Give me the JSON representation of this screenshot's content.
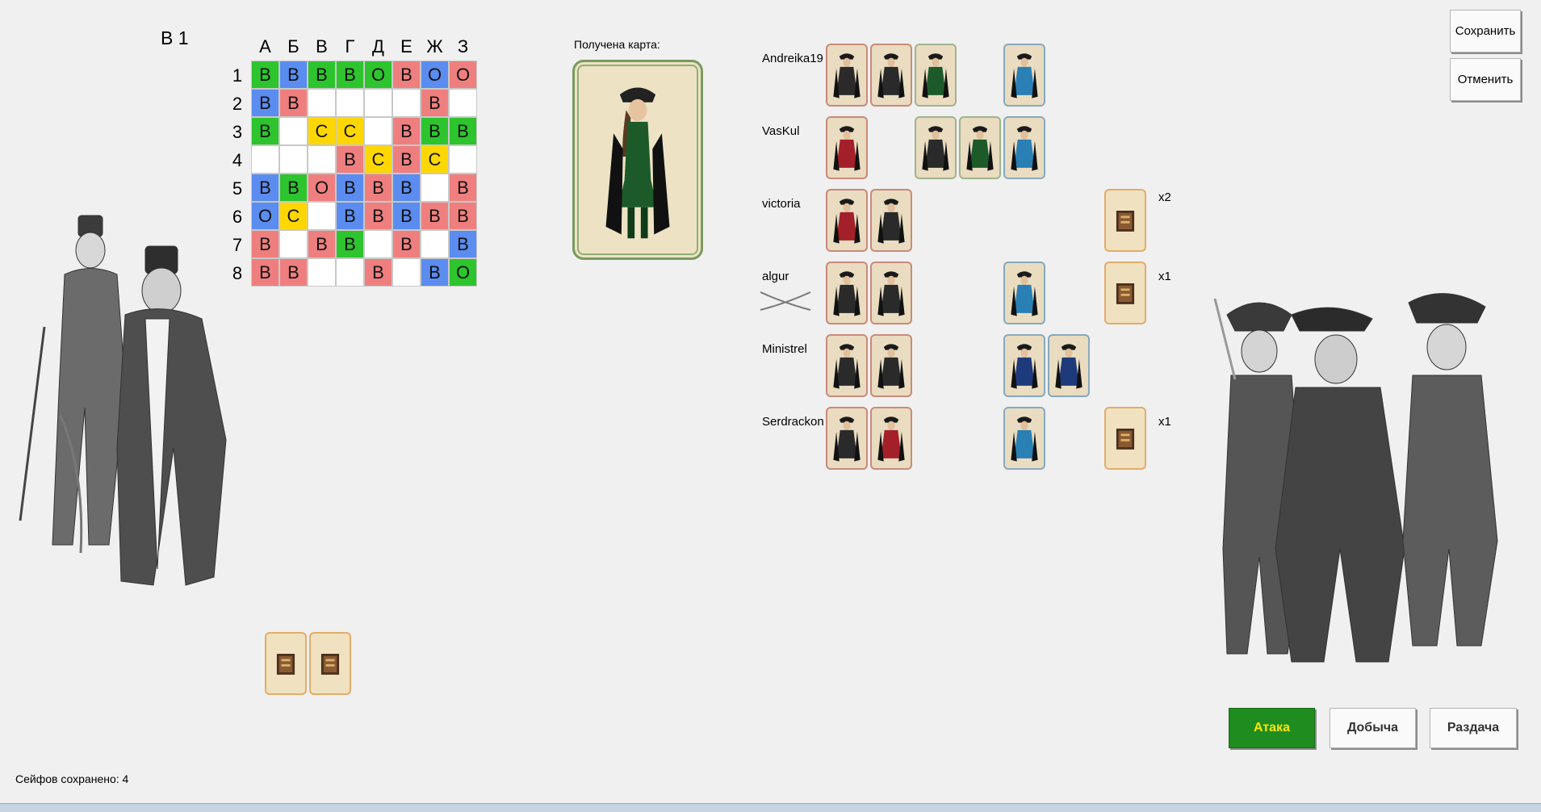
{
  "round": "В 1",
  "board": {
    "columns": [
      "А",
      "Б",
      "В",
      "Г",
      "Д",
      "Е",
      "Ж",
      "З"
    ],
    "rows": [
      "1",
      "2",
      "3",
      "4",
      "5",
      "6",
      "7",
      "8"
    ],
    "cells": [
      [
        {
          "t": "В",
          "c": "O"
        },
        {
          "t": "В",
          "c": "U"
        },
        {
          "t": "В",
          "c": "O"
        },
        {
          "t": "В",
          "c": "O"
        },
        {
          "t": "О",
          "c": "O"
        },
        {
          "t": "В",
          "c": "B"
        },
        {
          "t": "О",
          "c": "U"
        },
        {
          "t": "О",
          "c": "B"
        }
      ],
      [
        {
          "t": "В",
          "c": "U"
        },
        {
          "t": "В",
          "c": "B"
        },
        {
          "t": "",
          "c": ""
        },
        {
          "t": "",
          "c": ""
        },
        {
          "t": "",
          "c": ""
        },
        {
          "t": "",
          "c": ""
        },
        {
          "t": "В",
          "c": "B"
        },
        {
          "t": "",
          "c": ""
        }
      ],
      [
        {
          "t": "В",
          "c": "O"
        },
        {
          "t": "",
          "c": ""
        },
        {
          "t": "С",
          "c": "Y"
        },
        {
          "t": "С",
          "c": "Y"
        },
        {
          "t": "",
          "c": ""
        },
        {
          "t": "В",
          "c": "B"
        },
        {
          "t": "В",
          "c": "O"
        },
        {
          "t": "В",
          "c": "O"
        }
      ],
      [
        {
          "t": "",
          "c": ""
        },
        {
          "t": "",
          "c": ""
        },
        {
          "t": "",
          "c": ""
        },
        {
          "t": "В",
          "c": "B"
        },
        {
          "t": "С",
          "c": "Y"
        },
        {
          "t": "В",
          "c": "B"
        },
        {
          "t": "С",
          "c": "Y"
        },
        {
          "t": "",
          "c": ""
        }
      ],
      [
        {
          "t": "В",
          "c": "U"
        },
        {
          "t": "В",
          "c": "O"
        },
        {
          "t": "О",
          "c": "B"
        },
        {
          "t": "В",
          "c": "U"
        },
        {
          "t": "В",
          "c": "B"
        },
        {
          "t": "В",
          "c": "U"
        },
        {
          "t": "",
          "c": ""
        },
        {
          "t": "В",
          "c": "B"
        }
      ],
      [
        {
          "t": "О",
          "c": "U"
        },
        {
          "t": "С",
          "c": "Y"
        },
        {
          "t": "",
          "c": ""
        },
        {
          "t": "В",
          "c": "U"
        },
        {
          "t": "В",
          "c": "B"
        },
        {
          "t": "В",
          "c": "U"
        },
        {
          "t": "В",
          "c": "B"
        },
        {
          "t": "В",
          "c": "B"
        }
      ],
      [
        {
          "t": "В",
          "c": "B"
        },
        {
          "t": "",
          "c": ""
        },
        {
          "t": "В",
          "c": "B"
        },
        {
          "t": "В",
          "c": "O"
        },
        {
          "t": "",
          "c": ""
        },
        {
          "t": "В",
          "c": "B"
        },
        {
          "t": "",
          "c": ""
        },
        {
          "t": "В",
          "c": "U"
        }
      ],
      [
        {
          "t": "В",
          "c": "B"
        },
        {
          "t": "В",
          "c": "B"
        },
        {
          "t": "",
          "c": ""
        },
        {
          "t": "",
          "c": ""
        },
        {
          "t": "В",
          "c": "B"
        },
        {
          "t": "",
          "c": ""
        },
        {
          "t": "В",
          "c": "U"
        },
        {
          "t": "О",
          "c": "O"
        }
      ]
    ]
  },
  "received_card_label": "Получена карта:",
  "players": [
    {
      "name": "Andreika19",
      "cards": [
        {
          "slot": 0,
          "type": "pirate-dark",
          "border": "red"
        },
        {
          "slot": 1,
          "type": "pirate-dark",
          "border": "red"
        },
        {
          "slot": 2,
          "type": "pirate-green",
          "border": "green"
        },
        {
          "slot": 4,
          "type": "pirate-blue",
          "border": "blue"
        }
      ],
      "safe": false,
      "multiplier": ""
    },
    {
      "name": "VasKul",
      "cards": [
        {
          "slot": 0,
          "type": "pirate-red",
          "border": "red"
        },
        {
          "slot": 2,
          "type": "pirate-dark",
          "border": "green"
        },
        {
          "slot": 3,
          "type": "pirate-green",
          "border": "green"
        },
        {
          "slot": 4,
          "type": "pirate-blue",
          "border": "blue"
        }
      ],
      "safe": false,
      "multiplier": ""
    },
    {
      "name": "victoria",
      "cards": [
        {
          "slot": 0,
          "type": "pirate-red",
          "border": "red"
        },
        {
          "slot": 1,
          "type": "pirate-dark",
          "border": "red"
        }
      ],
      "safe": true,
      "multiplier": "x2"
    },
    {
      "name": "algur",
      "cards": [
        {
          "slot": 0,
          "type": "pirate-dark",
          "border": "red"
        },
        {
          "slot": 1,
          "type": "pirate-dark",
          "border": "red"
        },
        {
          "slot": 4,
          "type": "pirate-blue",
          "border": "blue"
        }
      ],
      "safe": true,
      "multiplier": "x1"
    },
    {
      "name": "Ministrel",
      "cards": [
        {
          "slot": 0,
          "type": "pirate-dark",
          "border": "red"
        },
        {
          "slot": 1,
          "type": "pirate-dark",
          "border": "red"
        },
        {
          "slot": 4,
          "type": "pirate-navy",
          "border": "blue"
        },
        {
          "slot": 5,
          "type": "pirate-navy",
          "border": "blue"
        }
      ],
      "safe": false,
      "multiplier": ""
    },
    {
      "name": "Serdrackon",
      "cards": [
        {
          "slot": 0,
          "type": "pirate-dark",
          "border": "red"
        },
        {
          "slot": 1,
          "type": "pirate-red",
          "border": "red"
        },
        {
          "slot": 4,
          "type": "pirate-blue",
          "border": "blue"
        }
      ],
      "safe": true,
      "multiplier": "x1"
    }
  ],
  "buttons": {
    "save": "Сохранить",
    "cancel": "Отменить",
    "attack": "Атака",
    "loot": "Добыча",
    "deal": "Раздача"
  },
  "footer": {
    "safes_saved": "Сейфов сохранено: 4"
  },
  "colors": {
    "red_cell": "#ef7f7f",
    "green_cell": "#2dc42d",
    "yellow_cell": "#ffd700",
    "blue_cell": "#5b8cf0",
    "attack_bg": "#1f8c1f",
    "attack_text": "#ffe600"
  }
}
